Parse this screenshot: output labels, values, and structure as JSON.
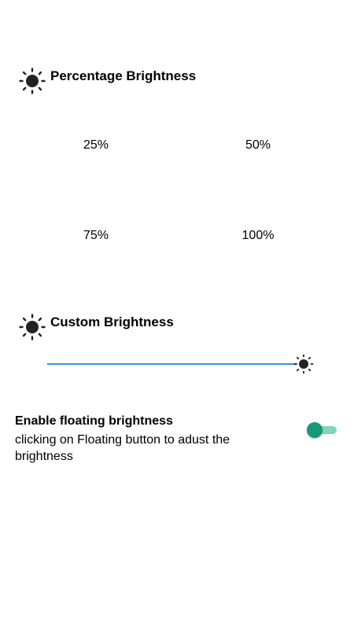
{
  "percentage_section": {
    "title": "Percentage Brightness",
    "icon": "sun-icon",
    "options": [
      "25%",
      "50%",
      "75%",
      "100%"
    ]
  },
  "custom_section": {
    "title": "Custom Brightness",
    "icon": "sun-icon",
    "slider": {
      "value_fraction": 1.0,
      "color": "#3b8fe6"
    }
  },
  "floating": {
    "title": "Enable floating brightness",
    "description": "clicking on Floating button to adust the brightness",
    "toggle": {
      "on": true,
      "track_color": "#7fd6b5",
      "knob_color": "#18977a"
    }
  }
}
